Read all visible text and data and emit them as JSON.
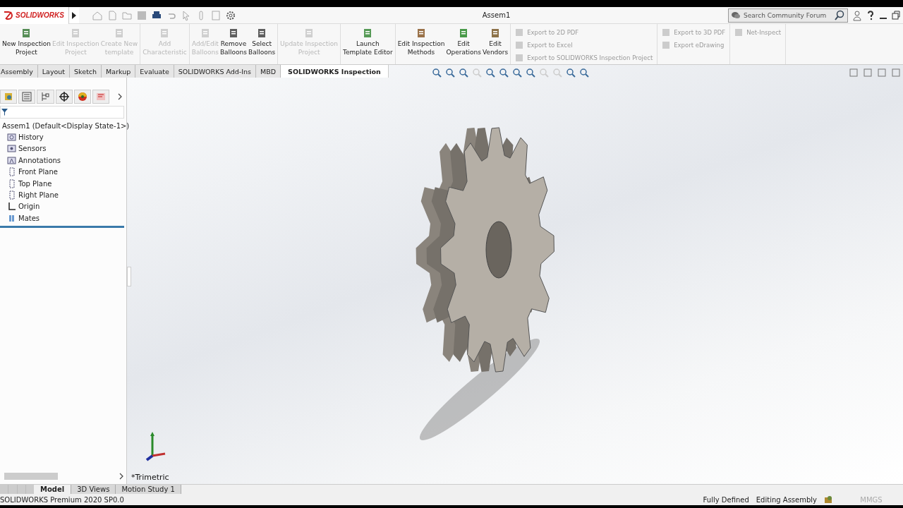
{
  "app": {
    "logo": "SOLIDWORKS",
    "document_title": "Assem1",
    "search": {
      "placeholder": "Search Community Forum"
    }
  },
  "ribbon": {
    "buttons": [
      {
        "label": "New Inspection\nProject",
        "disabled": false
      },
      {
        "label": "Edit Inspection\nProject",
        "disabled": true
      },
      {
        "label": "Create New\ntemplate",
        "disabled": true
      },
      {
        "label": "Add\nCharacteristic",
        "disabled": true
      },
      {
        "label": "Add/Edit\nBalloons",
        "disabled": true
      },
      {
        "label": "Remove\nBalloons",
        "disabled": false
      },
      {
        "label": "Select\nBalloons",
        "disabled": false
      },
      {
        "label": "Update Inspection\nProject",
        "disabled": true
      },
      {
        "label": "Launch\nTemplate Editor",
        "disabled": false
      },
      {
        "label": "Edit Inspection\nMethods",
        "disabled": false
      },
      {
        "label": "Edit\nOperations",
        "disabled": false
      },
      {
        "label": "Edit\nVendors",
        "disabled": false
      }
    ],
    "export_columns": [
      [
        {
          "label": "Export to 2D PDF",
          "disabled": true
        },
        {
          "label": "Export to Excel",
          "disabled": true
        },
        {
          "label": "Export to SOLIDWORKS Inspection Project",
          "disabled": true
        }
      ],
      [
        {
          "label": "Export to 3D PDF",
          "disabled": true
        },
        {
          "label": "Export eDrawing",
          "disabled": true
        }
      ],
      [
        {
          "label": "Net-Inspect",
          "disabled": true
        }
      ]
    ]
  },
  "tabs": [
    {
      "label": "Assembly",
      "selected": false
    },
    {
      "label": "Layout",
      "selected": false
    },
    {
      "label": "Sketch",
      "selected": false
    },
    {
      "label": "Markup",
      "selected": false
    },
    {
      "label": "Evaluate",
      "selected": false
    },
    {
      "label": "SOLIDWORKS Add-Ins",
      "selected": false
    },
    {
      "label": "MBD",
      "selected": false
    },
    {
      "label": "SOLIDWORKS Inspection",
      "selected": true
    }
  ],
  "feature_tree": {
    "root": {
      "label": "Assem1  (Default<Display State-1>)",
      "children": [
        {
          "label": "History"
        },
        {
          "label": "Sensors"
        },
        {
          "label": "Annotations"
        },
        {
          "label": "Front Plane"
        },
        {
          "label": "Top Plane"
        },
        {
          "label": "Right Plane"
        },
        {
          "label": "Origin"
        },
        {
          "label": "Mates"
        }
      ]
    }
  },
  "viewport": {
    "view_name": "*Trimetric"
  },
  "bottom_tabs": [
    {
      "label": "Model",
      "selected": true
    },
    {
      "label": "3D Views",
      "selected": false
    },
    {
      "label": "Motion Study 1",
      "selected": false
    }
  ],
  "status_bar": {
    "product": "SOLIDWORKS Premium 2020 SP0.0",
    "state": "Fully Defined",
    "mode": "Editing Assembly",
    "units": "MMGS"
  }
}
